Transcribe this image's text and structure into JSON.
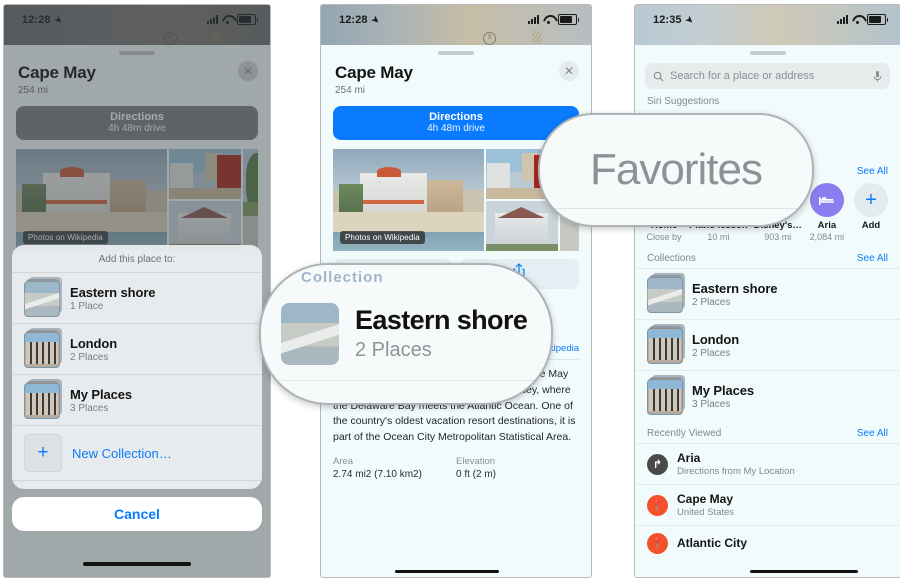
{
  "panel1": {
    "status": {
      "time": "12:28",
      "location_icon": "location-arrow-icon"
    },
    "place": {
      "title": "Cape May",
      "distance": "254 mi",
      "close_icon": "close-icon",
      "directions_label": "Directions",
      "directions_eta": "4h 48m drive",
      "photos_credit": "Photos on Wikipedia"
    },
    "modal": {
      "title": "Add this place to:",
      "collections": [
        {
          "name": "Eastern shore",
          "count": "1 Place"
        },
        {
          "name": "London",
          "count": "2 Places"
        },
        {
          "name": "My Places",
          "count": "3 Places"
        }
      ],
      "new_collection_label": "New Collection…",
      "new_collection_icon": "plus-icon",
      "cancel_label": "Cancel"
    }
  },
  "panel2": {
    "status": {
      "time": "12:28",
      "location_icon": "location-arrow-icon"
    },
    "place": {
      "title": "Cape May",
      "distance": "254 mi",
      "close_icon": "close-icon",
      "directions_label": "Directions",
      "directions_eta": "4h 48m drive",
      "photos_credit": "Photos on Wikipedia"
    },
    "actions": [
      {
        "label": "Collection",
        "icon": "collection-icon"
      },
      {
        "label": "",
        "icon": "share-icon"
      }
    ],
    "collection_row": {
      "name": "Eastern shore",
      "count": "2 Places"
    },
    "wikipedia": {
      "open_link": "Open Wikipedia",
      "body": "Cape May is a city at the southern tip of Cape May Peninsula in Cape May County, New Jersey, where the Delaware Bay meets the Atlantic Ocean. One of the country's oldest vacation resort destinations, it is part of the Ocean City Metropolitan Statistical Area.",
      "facts": [
        {
          "key": "Area",
          "value": "2.74 mi2 (7.10 km2)"
        },
        {
          "key": "Elevation",
          "value": "0 ft (2 m)"
        }
      ]
    },
    "callout": {
      "title": "Eastern shore",
      "subtitle": "2 Places",
      "ghost_text": "Collection"
    }
  },
  "panel3": {
    "status": {
      "time": "12:35",
      "location_icon": "location-arrow-icon"
    },
    "search": {
      "placeholder": "Search for a place or address",
      "search_icon": "search-icon",
      "mic_icon": "microphone-icon"
    },
    "sections": [
      {
        "title": "Siri Suggestions",
        "see_all": ""
      },
      {
        "title": "Favorites",
        "see_all": "See All"
      },
      {
        "title": "Collections",
        "see_all": "See All"
      },
      {
        "title": "Recently Viewed",
        "see_all": "See All"
      }
    ],
    "favorites": [
      {
        "name": "Home",
        "distance": "Close by",
        "icon": "house-icon",
        "color": "#f2566b"
      },
      {
        "name": "Piano lesson",
        "distance": "10 mi",
        "icon": "music-icon",
        "color": "#e95fb0"
      },
      {
        "name": "Disney's…",
        "distance": "903 mi",
        "icon": "castle-icon",
        "color": "#f24fb2"
      },
      {
        "name": "Aria",
        "distance": "2,084 mi",
        "icon": "bed-icon",
        "color": "#8b7cf0"
      },
      {
        "name": "Add",
        "distance": "",
        "icon": "plus-icon",
        "color": "#e4ebee"
      }
    ],
    "collections": [
      {
        "name": "Eastern shore",
        "count": "2 Places"
      },
      {
        "name": "London",
        "count": "2 Places"
      },
      {
        "name": "My Places",
        "count": "3 Places"
      }
    ],
    "recently_viewed": [
      {
        "name": "Aria",
        "subtitle": "Directions from My Location",
        "icon": "directions-icon",
        "color": "#4a4a4a"
      },
      {
        "name": "Cape May",
        "subtitle": "United States",
        "icon": "map-pin-icon",
        "color": "#f4502a"
      },
      {
        "name": "Atlantic City",
        "subtitle": "",
        "icon": "map-pin-icon",
        "color": "#f4502a"
      }
    ],
    "callout": {
      "title": "Favorites"
    }
  },
  "colors": {
    "accent": "#0a7bff",
    "sheet_bg": "#f2fbfb",
    "muted": "#82888b"
  }
}
